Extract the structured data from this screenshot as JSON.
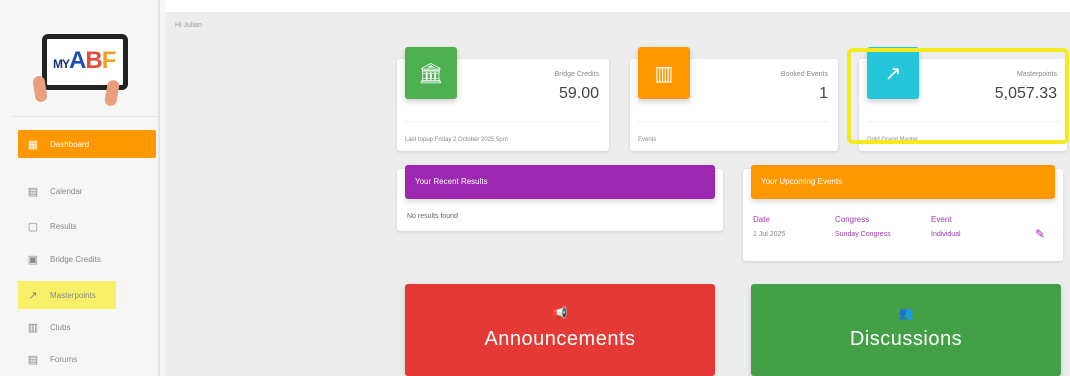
{
  "logo": {
    "my": "MY",
    "a": "A",
    "b": "B",
    "f": "F"
  },
  "sidebar": {
    "items": [
      {
        "label": "Dashboard",
        "icon": "dashboard-icon",
        "glyph": "▦"
      },
      {
        "label": "Calendar",
        "icon": "calendar-icon",
        "glyph": "▤"
      },
      {
        "label": "Results",
        "icon": "results-icon",
        "glyph": "▢"
      },
      {
        "label": "Bridge Credits",
        "icon": "credits-icon",
        "glyph": "▣"
      },
      {
        "label": "Masterpoints",
        "icon": "trending-up-icon",
        "glyph": "↗"
      },
      {
        "label": "Clubs",
        "icon": "clubs-icon",
        "glyph": "▥"
      },
      {
        "label": "Forums",
        "icon": "forums-icon",
        "glyph": "▤"
      }
    ]
  },
  "breadcrumb": "Hi Julian",
  "stats": {
    "credits": {
      "label": "Bridge Credits",
      "value": "59.00",
      "footer": "Last topup Friday 2 October 2025 5pm",
      "glyph": "🏛",
      "color": "#4caf50"
    },
    "events": {
      "label": "Booked Events",
      "value": "1",
      "footer": "Events",
      "glyph": "▥",
      "color": "#ff9800"
    },
    "masterpoints": {
      "label": "Masterpoints",
      "value": "5,057.33",
      "footer": "Gold Grand Master",
      "glyph": "↗",
      "color": "#26c6da"
    }
  },
  "results": {
    "title": "Your Recent Results",
    "empty": "No results found",
    "color": "#9c27b0"
  },
  "upcoming": {
    "title": "Your Upcoming Events",
    "color": "#ff9800",
    "headers": [
      "Date",
      "Congress",
      "Event"
    ],
    "row": [
      "1 Jul 2025",
      "Sunday Congress",
      "Individual"
    ]
  },
  "announcements": {
    "title": "Announcements",
    "glyph": "📢",
    "color": "#e53935"
  },
  "discussions": {
    "title": "Discussions",
    "glyph": "👥",
    "color": "#43a047"
  }
}
